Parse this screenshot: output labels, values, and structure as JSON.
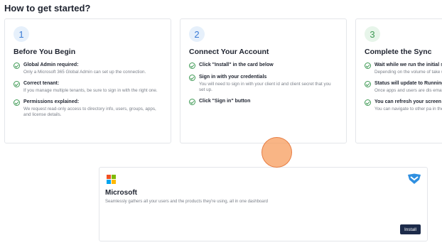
{
  "page": {
    "title": "How to get started?"
  },
  "cards": [
    {
      "number": "1",
      "title": "Before You Begin",
      "steps": [
        {
          "head": "Global Admin required:",
          "desc": "Only a Microsoft 365 Global Admin can set up the connection."
        },
        {
          "head": "Correct tenant:",
          "desc": "If you manage multiple tenants, be sure to sign in with the right one."
        },
        {
          "head": "Permissions explained:",
          "desc": "We request read-only access to directory info, users, groups, apps, and license details."
        }
      ]
    },
    {
      "number": "2",
      "title": "Connect Your Account",
      "steps": [
        {
          "head": "Click \"Install\" in the card below",
          "desc": ""
        },
        {
          "head": "Sign in with your credentials",
          "desc": "You will need to sign in with your client id and client secret that you set up."
        },
        {
          "head": "Click \"Sign in\" button",
          "desc": ""
        }
      ]
    },
    {
      "number": "3",
      "title": "Complete the Sync",
      "steps": [
        {
          "head": "Wait while we run the initial s",
          "desc": "Depending on the volume of take up to an hour."
        },
        {
          "head": "Status will update to Running",
          "desc": "Once apps and users are dis email and notification."
        },
        {
          "head": "You can refresh your screen",
          "desc": "You can navigate to other pa in the background."
        }
      ]
    }
  ],
  "integration": {
    "name": "Microsoft",
    "description": "Seamlessly gathers all your users and the products they're using, all in one dashboard",
    "install_label": "Install",
    "logo_colors": [
      "#f25022",
      "#7fba00",
      "#00a4ef",
      "#ffb900"
    ],
    "brand_icon": "shield-check-icon"
  },
  "colors": {
    "accent_blue": "#3a7bd5",
    "accent_green": "#3f9a55",
    "button": "#1c2b4a",
    "cursor": "#f79c5c"
  }
}
